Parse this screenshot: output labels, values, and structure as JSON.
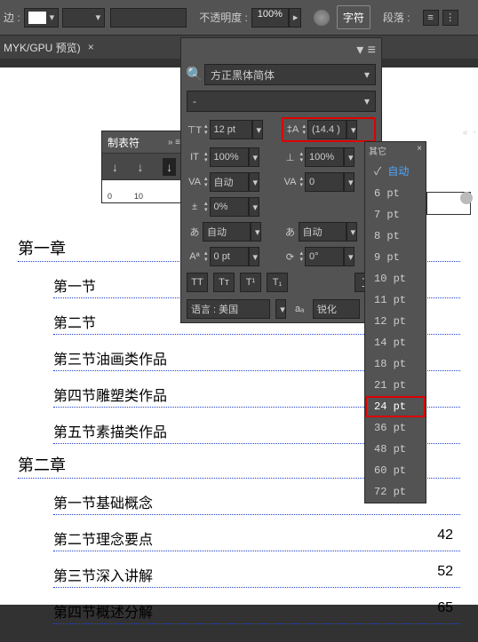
{
  "toolbar": {
    "stroke_label": "边 :",
    "opacity_label": "不透明度 :",
    "opacity_value": "100%"
  },
  "tabs": {
    "char": "字符",
    "para": "段落 :"
  },
  "doc_tab": "MYK/GPU 预览)",
  "tabs_panel": {
    "title": "制表符"
  },
  "ruler": {
    "a": "0",
    "b": "10"
  },
  "char_panel": {
    "font": "方正黑体简体",
    "style": "-",
    "size": "12 pt",
    "leading": "(14.4 )",
    "vscale": "100%",
    "hscale": "100%",
    "kerning": "自动",
    "tracking": "0",
    "spacing": "0%",
    "auto1": "自动",
    "auto2": "自动",
    "baseline": "0 pt",
    "rotation": "0°",
    "lang": "语言 : 美国",
    "aa": "锐化"
  },
  "leading_popup": {
    "header": "其它",
    "items": [
      "自动",
      "6 pt",
      "7 pt",
      "8 pt",
      "9 pt",
      "10 pt",
      "11 pt",
      "12 pt",
      "14 pt",
      "18 pt",
      "21 pt",
      "24 pt",
      "36 pt",
      "48 pt",
      "60 pt",
      "72 pt"
    ]
  },
  "toc": {
    "ch1": "第一章",
    "ch1_items": [
      {
        "t": "第一节",
        "p": ""
      },
      {
        "t": "第二节",
        "p": ""
      },
      {
        "t": "第三节油画类作品",
        "p": ""
      },
      {
        "t": "第四节雕塑类作品",
        "p": ""
      },
      {
        "t": "第五节素描类作品",
        "p": ""
      }
    ],
    "ch2": "第二章",
    "ch2_items": [
      {
        "t": "第一节基础概念",
        "p": ""
      },
      {
        "t": "第二节理念要点",
        "p": "42"
      },
      {
        "t": "第三节深入讲解",
        "p": "52"
      },
      {
        "t": "第四节概述分解",
        "p": "65"
      }
    ]
  }
}
